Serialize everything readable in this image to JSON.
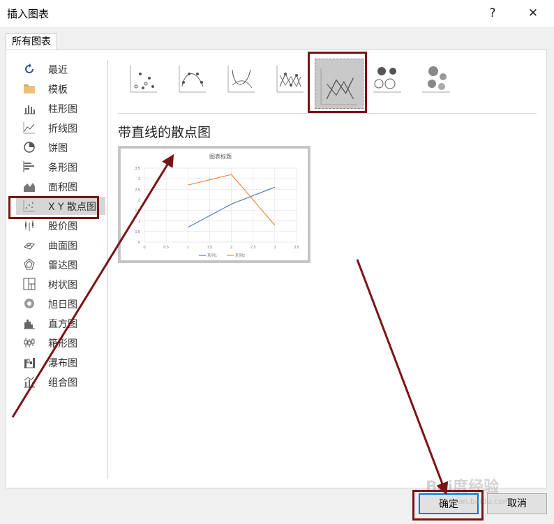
{
  "window": {
    "title": "插入图表",
    "help": "?",
    "close": "✕"
  },
  "tab": {
    "label": "所有图表"
  },
  "sidebar": {
    "items": [
      {
        "label": "最近",
        "icon": "recent-icon"
      },
      {
        "label": "模板",
        "icon": "folder-icon"
      },
      {
        "label": "柱形图",
        "icon": "column-chart-icon"
      },
      {
        "label": "折线图",
        "icon": "line-chart-icon"
      },
      {
        "label": "饼图",
        "icon": "pie-chart-icon"
      },
      {
        "label": "条形图",
        "icon": "bar-chart-icon"
      },
      {
        "label": "面积图",
        "icon": "area-chart-icon"
      },
      {
        "label": "X Y 散点图",
        "icon": "scatter-chart-icon",
        "selected": true
      },
      {
        "label": "股价图",
        "icon": "stock-chart-icon"
      },
      {
        "label": "曲面图",
        "icon": "surface-chart-icon"
      },
      {
        "label": "雷达图",
        "icon": "radar-chart-icon"
      },
      {
        "label": "树状图",
        "icon": "treemap-chart-icon"
      },
      {
        "label": "旭日图",
        "icon": "sunburst-chart-icon"
      },
      {
        "label": "直方图",
        "icon": "histogram-chart-icon"
      },
      {
        "label": "箱形图",
        "icon": "box-whisker-chart-icon"
      },
      {
        "label": "瀑布图",
        "icon": "waterfall-chart-icon"
      },
      {
        "label": "组合图",
        "icon": "combo-chart-icon"
      }
    ]
  },
  "subtypes": [
    {
      "icon": "scatter-markers-icon"
    },
    {
      "icon": "scatter-smooth-markers-icon"
    },
    {
      "icon": "scatter-smooth-lines-icon"
    },
    {
      "icon": "scatter-straight-markers-icon"
    },
    {
      "icon": "scatter-straight-lines-icon",
      "selected": true
    },
    {
      "icon": "bubble-icon"
    },
    {
      "icon": "bubble-3d-icon"
    }
  ],
  "selected_subtype_title": "带直线的散点图",
  "chart_data": {
    "type": "scatter",
    "title": "图表标题",
    "xlabel": "",
    "ylabel": "",
    "xlim": [
      0,
      3.5
    ],
    "ylim": [
      0,
      3.5
    ],
    "x_ticks": [
      "0",
      "0.5",
      "1",
      "1.5",
      "2",
      "2.5",
      "3",
      "3.5"
    ],
    "y_ticks": [
      "0",
      "0.5",
      "1",
      "1.5",
      "2",
      "2.5",
      "3",
      "3.5"
    ],
    "grid": true,
    "legend": "bottom",
    "series": [
      {
        "name": "系列1",
        "color": "#4472c4",
        "x": [
          1,
          2,
          3
        ],
        "y": [
          0.7,
          1.8,
          2.6
        ]
      },
      {
        "name": "系列2",
        "color": "#ed7d31",
        "x": [
          1,
          2,
          3
        ],
        "y": [
          2.7,
          3.2,
          0.8
        ]
      }
    ]
  },
  "buttons": {
    "ok": "确定",
    "cancel": "取消"
  },
  "watermark": {
    "brand": "Bai度经验",
    "url": "jingyan.baidu.com"
  },
  "accent_colors": {
    "highlight": "#7a1316",
    "focus": "#0078d7"
  }
}
